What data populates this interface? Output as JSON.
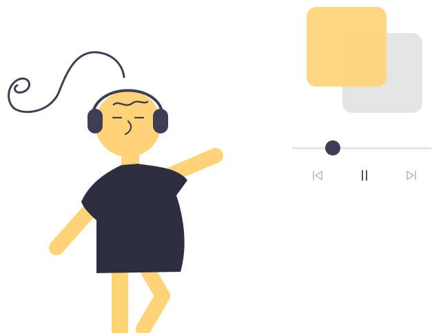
{
  "player": {
    "progress_fraction": 0.29,
    "controls": {
      "prev_icon": "skip-previous-icon",
      "pause_icon": "pause-icon",
      "next_icon": "skip-next-icon"
    }
  },
  "colors": {
    "accent": "#ffd478",
    "art_back": "#e4e4e4",
    "dark": "#3f3d56",
    "track": "#e6e6e6",
    "control_icon": "#b9b9b9",
    "skin": "#ffd478"
  }
}
